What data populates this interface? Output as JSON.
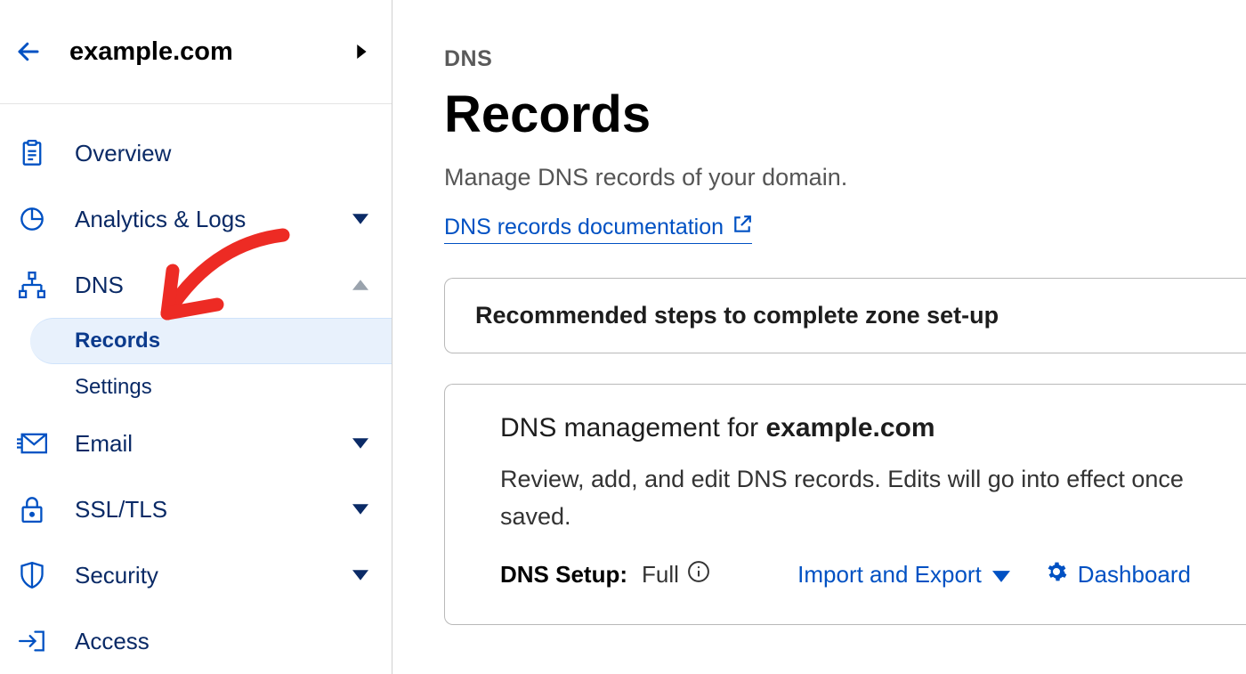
{
  "domain": {
    "name": "example.com"
  },
  "sidebar": {
    "items": [
      {
        "label": "Overview",
        "icon": "clipboard",
        "expandable": false
      },
      {
        "label": "Analytics & Logs",
        "icon": "pie",
        "expandable": true,
        "expanded": false
      },
      {
        "label": "DNS",
        "icon": "sitemap",
        "expandable": true,
        "expanded": true,
        "children": [
          {
            "label": "Records",
            "active": true
          },
          {
            "label": "Settings",
            "active": false
          }
        ]
      },
      {
        "label": "Email",
        "icon": "envelope",
        "expandable": true,
        "expanded": false
      },
      {
        "label": "SSL/TLS",
        "icon": "lock",
        "expandable": true,
        "expanded": false
      },
      {
        "label": "Security",
        "icon": "shield",
        "expandable": true,
        "expanded": false
      },
      {
        "label": "Access",
        "icon": "login",
        "expandable": false
      }
    ]
  },
  "main": {
    "breadcrumb": "DNS",
    "title": "Records",
    "subtitle": "Manage DNS records of your domain.",
    "doc_link_label": "DNS records documentation",
    "steps_panel": "Recommended steps to complete zone set-up",
    "mgmt_title_prefix": "DNS management for ",
    "mgmt_title_domain": "example.com",
    "mgmt_desc": "Review, add, and edit DNS records. Edits will go into effect once saved.",
    "setup_label": "DNS Setup:",
    "setup_value": "Full",
    "import_export": "Import and Export",
    "dashboard": "Dashboard"
  }
}
